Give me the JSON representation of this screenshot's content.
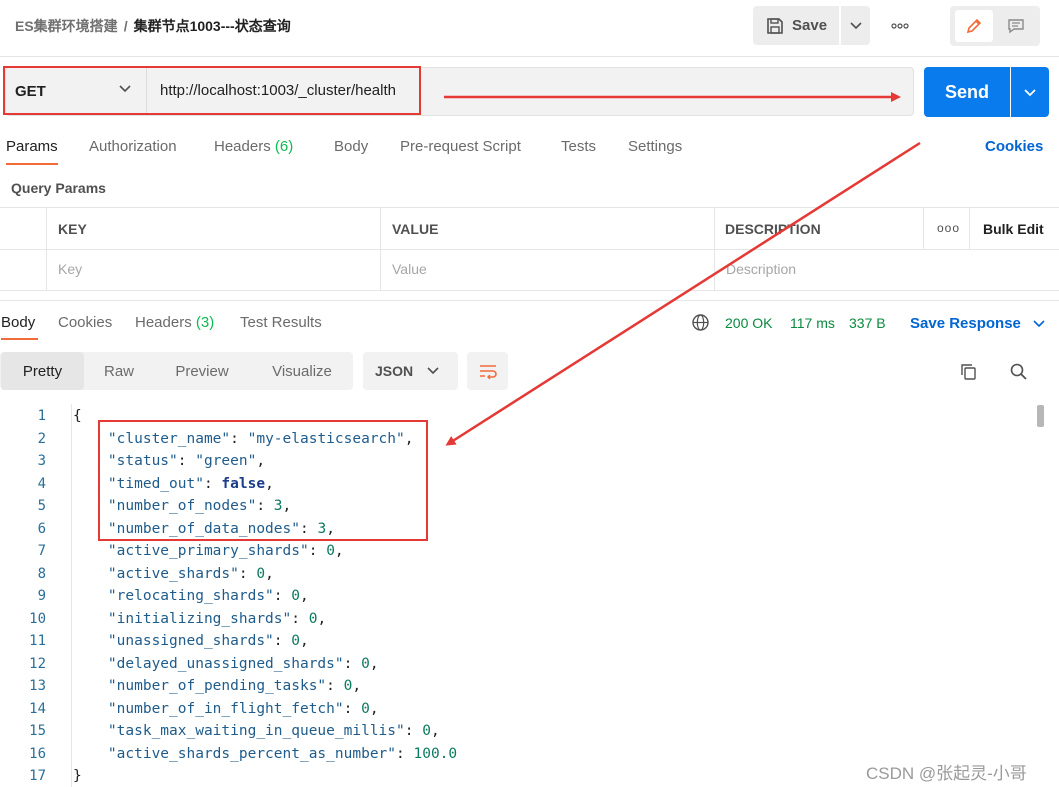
{
  "breadcrumb": {
    "parent": "ES集群环境搭建",
    "separator": "/",
    "current": "集群节点1003---状态查询"
  },
  "header": {
    "save_label": "Save",
    "more_icon": "more-horizontal-icon",
    "edit_icon": "pencil-icon",
    "comment_icon": "comment-icon"
  },
  "request": {
    "method": "GET",
    "url": "http://localhost:1003/_cluster/health",
    "send_label": "Send"
  },
  "request_tabs": [
    {
      "label": "Params"
    },
    {
      "label": "Authorization"
    },
    {
      "label": "Headers",
      "count": "(6)"
    },
    {
      "label": "Body"
    },
    {
      "label": "Pre-request Script"
    },
    {
      "label": "Tests"
    },
    {
      "label": "Settings"
    }
  ],
  "cookies_label": "Cookies",
  "query_params": {
    "title": "Query Params",
    "columns": [
      "KEY",
      "VALUE",
      "DESCRIPTION"
    ],
    "bulk_edit": "Bulk Edit",
    "more": "ooo",
    "placeholders": [
      "Key",
      "Value",
      "Description"
    ]
  },
  "response_tabs": [
    {
      "label": "Body"
    },
    {
      "label": "Cookies"
    },
    {
      "label": "Headers",
      "count": "(3)"
    },
    {
      "label": "Test Results"
    }
  ],
  "response_status": {
    "code": "200 OK",
    "time": "117 ms",
    "size": "337 B",
    "save_response": "Save Response"
  },
  "format_tabs": [
    "Pretty",
    "Raw",
    "Preview",
    "Visualize"
  ],
  "format_select": "JSON",
  "json_lines": [
    {
      "n": "1",
      "t": "{"
    },
    {
      "n": "2",
      "k": "\"cluster_name\"",
      "v": "\"my-elasticsearch\"",
      "vt": "s",
      "c": true
    },
    {
      "n": "3",
      "k": "\"status\"",
      "v": "\"green\"",
      "vt": "s",
      "c": true
    },
    {
      "n": "4",
      "k": "\"timed_out\"",
      "v": "false",
      "vt": "b",
      "c": true
    },
    {
      "n": "5",
      "k": "\"number_of_nodes\"",
      "v": "3",
      "vt": "n",
      "c": true
    },
    {
      "n": "6",
      "k": "\"number_of_data_nodes\"",
      "v": "3",
      "vt": "n",
      "c": true
    },
    {
      "n": "7",
      "k": "\"active_primary_shards\"",
      "v": "0",
      "vt": "n",
      "c": true
    },
    {
      "n": "8",
      "k": "\"active_shards\"",
      "v": "0",
      "vt": "n",
      "c": true
    },
    {
      "n": "9",
      "k": "\"relocating_shards\"",
      "v": "0",
      "vt": "n",
      "c": true
    },
    {
      "n": "10",
      "k": "\"initializing_shards\"",
      "v": "0",
      "vt": "n",
      "c": true
    },
    {
      "n": "11",
      "k": "\"unassigned_shards\"",
      "v": "0",
      "vt": "n",
      "c": true
    },
    {
      "n": "12",
      "k": "\"delayed_unassigned_shards\"",
      "v": "0",
      "vt": "n",
      "c": true
    },
    {
      "n": "13",
      "k": "\"number_of_pending_tasks\"",
      "v": "0",
      "vt": "n",
      "c": true
    },
    {
      "n": "14",
      "k": "\"number_of_in_flight_fetch\"",
      "v": "0",
      "vt": "n",
      "c": true
    },
    {
      "n": "15",
      "k": "\"task_max_waiting_in_queue_millis\"",
      "v": "0",
      "vt": "n",
      "c": true
    },
    {
      "n": "16",
      "k": "\"active_shards_percent_as_number\"",
      "v": "100.0",
      "vt": "n",
      "c": false
    },
    {
      "n": "17",
      "t": "}"
    }
  ],
  "watermark": "CSDN @张起灵-小哥",
  "colors": {
    "accent": "#097bed",
    "tab_underline": "#f26b3a",
    "annotation_red": "#e53935",
    "status_green": "#0a8a3f"
  }
}
